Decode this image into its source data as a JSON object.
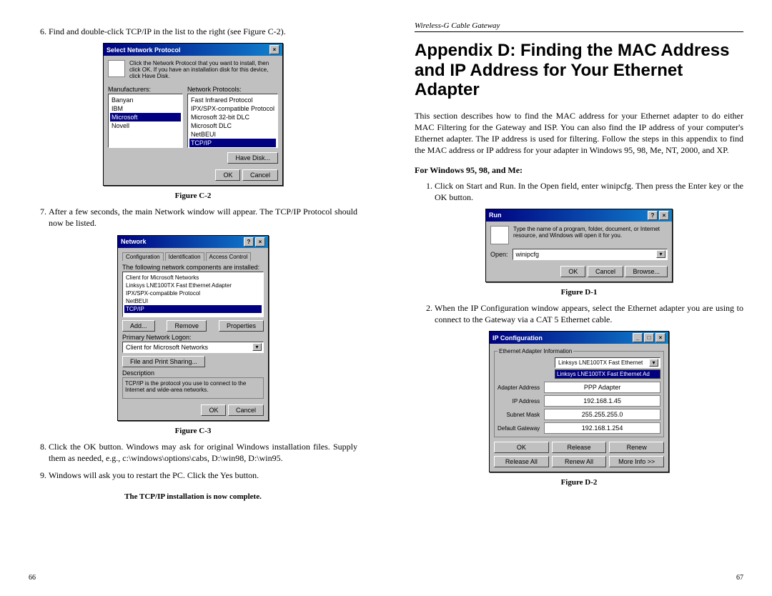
{
  "left": {
    "step6": "Find and double-click TCP/IP in the list to the right (see Figure C-2).",
    "figC2": "Figure C-2",
    "step7": "After a few seconds, the main Network window will appear.  The TCP/IP Protocol should now be listed.",
    "figC3": "Figure C-3",
    "step8": "Click the OK button. Windows may ask for original Windows installation files. Supply them as needed, e.g., c:\\windows\\options\\cabs, D:\\win98, D:\\win95.",
    "step9": "Windows will ask you to restart the PC. Click the Yes button.",
    "complete": "The TCP/IP installation is now complete.",
    "pagenum": "66",
    "dlgC2": {
      "title": "Select Network Protocol",
      "instruction": "Click the Network Protocol that you want to install, then click OK. If you have an installation disk for this device, click Have Disk.",
      "manuf_label": "Manufacturers:",
      "proto_label": "Network Protocols:",
      "manufacturers": [
        "Banyan",
        "IBM",
        "Microsoft",
        "Novell"
      ],
      "protocols": [
        "Fast Infrared Protocol",
        "IPX/SPX-compatible Protocol",
        "Microsoft 32-bit DLC",
        "Microsoft DLC",
        "NetBEUI",
        "TCP/IP"
      ],
      "havedisk": "Have Disk...",
      "ok": "OK",
      "cancel": "Cancel"
    },
    "dlgC3": {
      "title": "Network",
      "tabs": [
        "Configuration",
        "Identification",
        "Access Control"
      ],
      "listlabel": "The following network components are installed:",
      "items": [
        "Client for Microsoft Networks",
        "Linksys LNE100TX Fast Ethernet Adapter",
        "IPX/SPX-compatible Protocol",
        "NetBEUI",
        "TCP/IP"
      ],
      "add": "Add...",
      "remove": "Remove",
      "props": "Properties",
      "logon_label": "Primary Network Logon:",
      "logon_value": "Client for Microsoft Networks",
      "fps": "File and Print Sharing...",
      "desc_label": "Description",
      "desc": "TCP/IP is the protocol you use to connect to the Internet and wide-area networks.",
      "ok": "OK",
      "cancel": "Cancel"
    }
  },
  "right": {
    "header": "Wireless-G Cable Gateway",
    "title": "Appendix D: Finding the MAC Address and IP Address for Your Ethernet Adapter",
    "intro": "This section describes how to find the MAC address for your Ethernet adapter to do either MAC Filtering for the Gateway and ISP.  You can also find the IP address of your computer's Ethernet adapter.  The IP address is used for filtering.  Follow the steps in this appendix to find the MAC address or IP address for your adapter in Windows 95, 98, Me, NT, 2000, and XP.",
    "subhead": "For Windows 95, 98, and Me:",
    "step1": "Click on Start and Run. In the Open field, enter winipcfg. Then press the Enter key or the OK button.",
    "figD1": "Figure D-1",
    "step2": "When the IP Configuration window appears, select the Ethernet adapter you are using to connect to the Gateway via a CAT 5 Ethernet cable.",
    "figD2": "Figure D-2",
    "pagenum": "67",
    "dlgRun": {
      "title": "Run",
      "text": "Type the name of a program, folder, document, or Internet resource, and Windows will open it for you.",
      "open_label": "Open:",
      "open_value": "winipcfg",
      "ok": "OK",
      "cancel": "Cancel",
      "browse": "Browse..."
    },
    "dlgIP": {
      "title": "IP Configuration",
      "group": "Ethernet Adapter Information",
      "dropdown_sel": "Linksys LNE100TX Fast Ethernet",
      "dropdown_opt": "Linksys LNE100TX Fast Ethernet Ad",
      "adapter_addr_label": "Adapter Address",
      "adapter_addr": "PPP Adapter",
      "ip_label": "IP Address",
      "ip": "192.168.1.45",
      "mask_label": "Subnet Mask",
      "mask": "255.255.255.0",
      "gw_label": "Default Gateway",
      "gw": "192.168.1.254",
      "ok": "OK",
      "release": "Release",
      "renew": "Renew",
      "release_all": "Release All",
      "renew_all": "Renew All",
      "more": "More Info >>"
    }
  }
}
